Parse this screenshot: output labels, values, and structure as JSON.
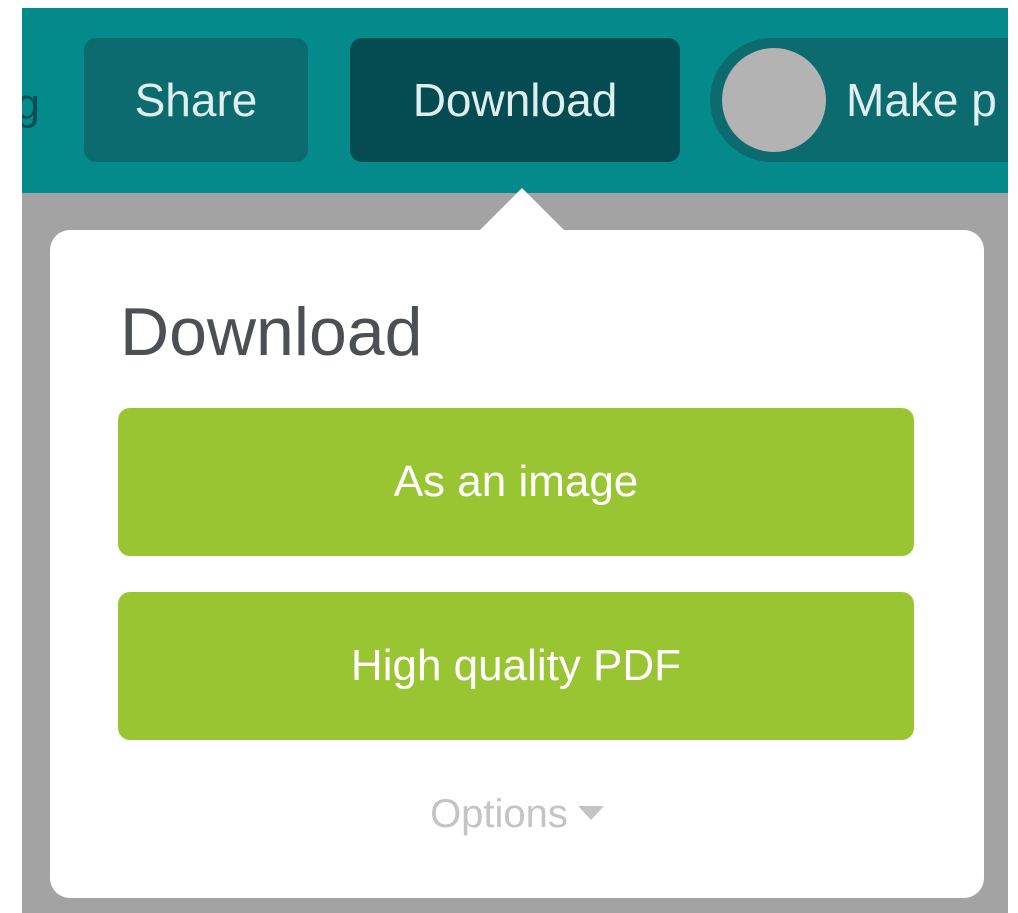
{
  "toolbar": {
    "cutoff_label": "g",
    "share_label": "Share",
    "download_label": "Download",
    "make_public_label": "Make p",
    "colors": {
      "bar": "#058a8c",
      "share": "#0b6b6e",
      "download_active": "#054b52"
    }
  },
  "popover": {
    "title": "Download",
    "buttons": [
      {
        "label": "As an image"
      },
      {
        "label": "High quality PDF"
      }
    ],
    "options_label": "Options",
    "options_icon": "caret-down-icon",
    "colors": {
      "button": "#9ac532",
      "background": "#ffffff"
    }
  }
}
